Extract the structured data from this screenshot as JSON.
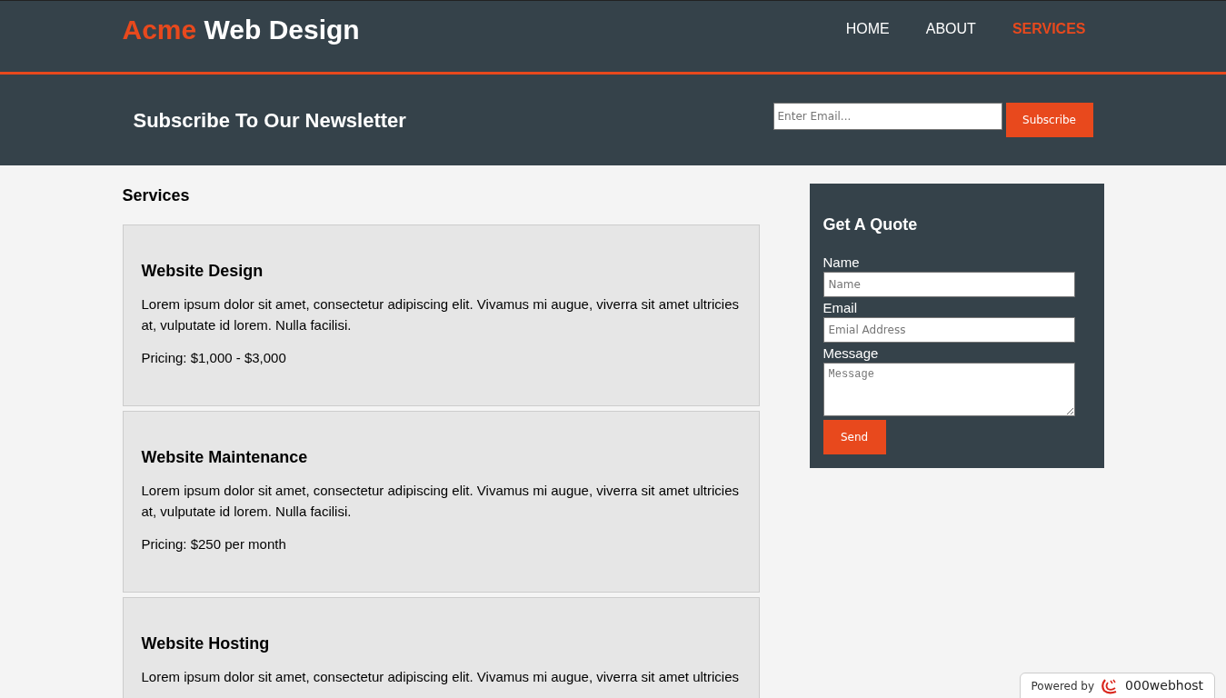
{
  "header": {
    "logo": {
      "highlight": "Acme",
      "text": "Web Design"
    },
    "nav": [
      {
        "label": "HOME",
        "selected": false
      },
      {
        "label": "ABOUT",
        "selected": false
      },
      {
        "label": "SERVICES",
        "selected": true
      }
    ]
  },
  "newsletter": {
    "title": "Subscribe To Our Newsletter",
    "email": {
      "placeholder": "Enter Email..."
    },
    "button": "Subscribe"
  },
  "main": {
    "title": "Services",
    "services": [
      {
        "title": "Website Design",
        "description": "Lorem ipsum dolor sit amet, consectetur adipiscing elit. Vivamus mi augue, viverra sit amet ultricies at, vulputate id lorem. Nulla facilisi.",
        "pricing": "Pricing: $1,000 - $3,000"
      },
      {
        "title": "Website Maintenance",
        "description": "Lorem ipsum dolor sit amet, consectetur adipiscing elit. Vivamus mi augue, viverra sit amet ultricies at, vulputate id lorem. Nulla facilisi.",
        "pricing": "Pricing: $250 per month"
      },
      {
        "title": "Website Hosting",
        "description": "Lorem ipsum dolor sit amet, consectetur adipiscing elit. Vivamus mi augue, viverra sit amet ultricies"
      }
    ]
  },
  "quote": {
    "title": "Get A Quote",
    "fields": [
      {
        "kind": "input",
        "label": "Name",
        "placeholder": "Name"
      },
      {
        "kind": "input",
        "label": "Email",
        "placeholder": "Emial Address"
      },
      {
        "kind": "textarea",
        "label": "Message",
        "placeholder": "Message"
      }
    ],
    "button": "Send"
  },
  "badge": {
    "prefix": "Powered by",
    "brand": "000webhost"
  }
}
